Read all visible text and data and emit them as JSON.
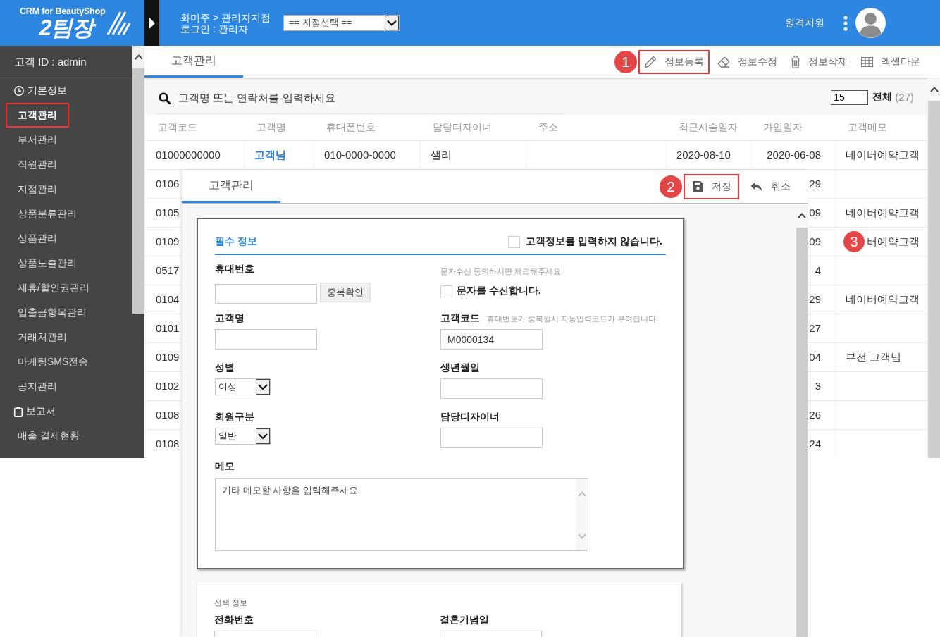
{
  "header": {
    "logo_caption": "CRM for BeautyShop",
    "logo_title": "2팀장",
    "breadcrumb": "화미주 > 관리자지점",
    "login": "로그인 : 관리자",
    "branch_select": "== 지점선택 ==",
    "remote_support": "원격지원"
  },
  "sidebar": {
    "user_id": "고객 ID : admin",
    "sections": [
      {
        "title": "기본정보",
        "items": [
          {
            "label": "고객관리",
            "selected": true,
            "annotated": true
          },
          {
            "label": "부서관리",
            "selected": false,
            "annotated": false
          },
          {
            "label": "직원관리",
            "selected": false,
            "annotated": false
          },
          {
            "label": "지점관리",
            "selected": false,
            "annotated": false
          },
          {
            "label": "상품분류관리",
            "selected": false,
            "annotated": false
          },
          {
            "label": "상품관리",
            "selected": false,
            "annotated": false
          },
          {
            "label": "상품노출관리",
            "selected": false,
            "annotated": false
          },
          {
            "label": "제휴/할인권관리",
            "selected": false,
            "annotated": false
          },
          {
            "label": "입출금항목관리",
            "selected": false,
            "annotated": false
          },
          {
            "label": "거래처관리",
            "selected": false,
            "annotated": false
          },
          {
            "label": "마케팅SMS전송",
            "selected": false,
            "annotated": false
          },
          {
            "label": "공지관리",
            "selected": false,
            "annotated": false
          }
        ]
      },
      {
        "title": "보고서",
        "items": [
          {
            "label": "매출 결제현황",
            "selected": false,
            "annotated": false
          }
        ]
      }
    ]
  },
  "main": {
    "tabs": [
      {
        "label": "고객관리",
        "selected": true
      }
    ],
    "toolbar": [
      {
        "label": "정보등록",
        "annotated": true,
        "callout": "1"
      },
      {
        "label": "정보수정",
        "annotated": false
      },
      {
        "label": "정보삭제",
        "annotated": false
      },
      {
        "label": "엑셀다운",
        "annotated": false
      }
    ],
    "search": {
      "placeholder": "고객명 또는 연락처를 입력하세요"
    },
    "page_size": "15",
    "total_label": "전체",
    "total_count": "(27)",
    "table": {
      "columns": [
        "고객코드",
        "고객명",
        "휴대폰번호",
        "담당디자이너",
        "주소",
        "최근시술일자",
        "가입일자",
        "고객메모"
      ],
      "rows": [
        {
          "code": "01000000000",
          "name": "고객님",
          "phone": "010-0000-0000",
          "designer": "샐리",
          "last_visit": "2020-08-10",
          "joined": "2020-06-08",
          "memo": "네이버예약고객"
        },
        {
          "code": "0106",
          "joined": "29"
        },
        {
          "code": "0105",
          "joined": "09",
          "memo": "네이버예약고객"
        },
        {
          "code": "0109",
          "joined": "09",
          "memo": "버예약고객",
          "callout": "3"
        },
        {
          "code": "0517",
          "joined": "4"
        },
        {
          "code": "0104",
          "joined": "29",
          "memo": "네이버예약고객"
        },
        {
          "code": "0101",
          "joined": "27"
        },
        {
          "code": "0109",
          "joined": "04",
          "memo": "부전 고객님"
        },
        {
          "code": "0102",
          "joined": "3"
        },
        {
          "code": "0108",
          "joined": "26"
        },
        {
          "code": "0108",
          "joined": "24"
        }
      ]
    }
  },
  "modal": {
    "tabs": [
      {
        "label": "고객관리",
        "selected": true
      }
    ],
    "actions": [
      {
        "label": "저장",
        "annotated": true,
        "callout": "2"
      },
      {
        "label": "취소",
        "annotated": false
      }
    ],
    "required": {
      "title": "필수 정보",
      "opt_out": {
        "label": "고객정보를 입력하지 않습니다.",
        "checked": false
      },
      "fields": [
        {
          "kind": "input_button",
          "label": "휴대번호",
          "button": "중복확인"
        },
        {
          "kind": "checkbox",
          "hint": "문자수신 동의하시면 체크해주세요.",
          "label": "문자를 수신합니다.",
          "checked": false
        },
        {
          "kind": "input",
          "label": "고객명"
        },
        {
          "kind": "input",
          "label": "고객코드",
          "hint": "휴대번호가 중복될시 자동입력코드가 부여됩니다.",
          "value": "M0000134"
        },
        {
          "kind": "select",
          "label": "성별",
          "value": "여성"
        },
        {
          "kind": "input",
          "label": "생년월일"
        },
        {
          "kind": "select",
          "label": "회원구분",
          "value": "일반"
        },
        {
          "kind": "input",
          "label": "담당디자이너"
        },
        {
          "kind": "textarea",
          "label": "메모",
          "placeholder": "기타 메모할 사항을 입력해주세요."
        }
      ]
    },
    "optional": {
      "title": "선택 정보",
      "fields": [
        {
          "kind": "input",
          "label": "전화번호"
        },
        {
          "kind": "input",
          "label": "결혼기념일"
        }
      ]
    }
  }
}
